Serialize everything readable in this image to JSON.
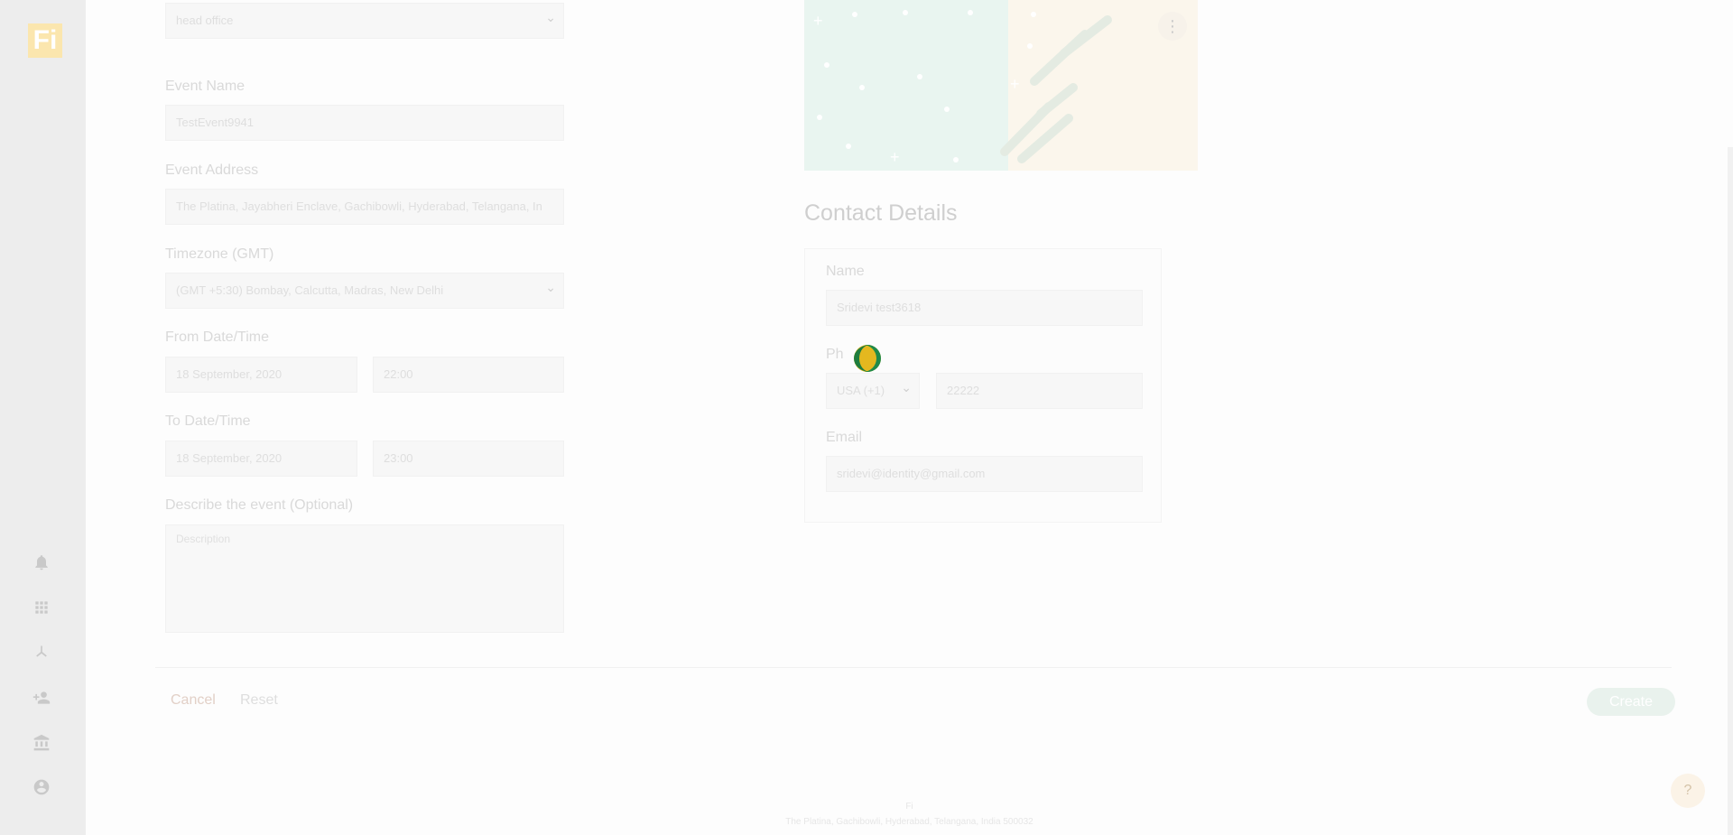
{
  "app": {
    "logo_text": "Fi",
    "colors": {
      "brand": "#f2c94c",
      "accent_green": "#1e7d3e",
      "spinner_yellow": "#e4b81f"
    }
  },
  "sidebar": {
    "collapse_icon": "chevron-right-icon",
    "items": [
      {
        "icon": "bell-icon"
      },
      {
        "icon": "grid-icon"
      },
      {
        "icon": "network-icon"
      },
      {
        "icon": "add-user-icon"
      },
      {
        "icon": "bank-icon"
      },
      {
        "icon": "account-icon"
      }
    ]
  },
  "form": {
    "location_value": "head office",
    "event_name": {
      "label": "Event Name",
      "value": "TestEvent9941"
    },
    "event_address": {
      "label": "Event Address",
      "value": "The Platina, Jayabheri Enclave, Gachibowli, Hyderabad, Telangana, In"
    },
    "timezone": {
      "label": "Timezone (GMT)",
      "value": "(GMT +5:30) Bombay, Calcutta, Madras, New Delhi"
    },
    "from": {
      "label": "From Date/Time",
      "date": "18 September, 2020",
      "time": "22:00"
    },
    "to": {
      "label": "To Date/Time",
      "date": "18 September, 2020",
      "time": "23:00"
    },
    "description": {
      "label": "Describe the event (Optional)",
      "placeholder": "Description"
    }
  },
  "contact": {
    "title": "Contact Details",
    "name": {
      "label": "Name",
      "value": "Sridevi test3618"
    },
    "phone": {
      "label": "Ph",
      "country": "USA (+1)",
      "number": "22222"
    },
    "email": {
      "label": "Email",
      "value": "sridevi@identity@gmail.com"
    }
  },
  "actions": {
    "cancel": "Cancel",
    "reset": "Reset",
    "create": "Create"
  },
  "footer": {
    "line1": "Fi",
    "line2": "The Platina, Gachibowli, Hyderabad, Telangana, India 500032"
  }
}
